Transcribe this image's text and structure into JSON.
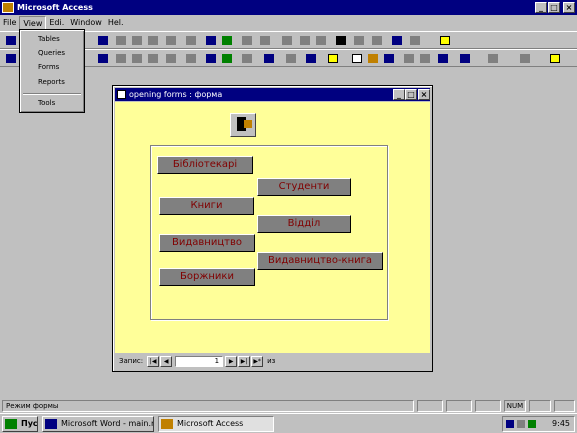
{
  "app": {
    "title": "Microsoft Access"
  },
  "window_buttons": [
    "_",
    "□",
    "×"
  ],
  "menu": [
    "File",
    "View",
    "Edi.",
    "Window",
    "Hel."
  ],
  "view_menu": {
    "items": [
      "Tables",
      "Queries",
      "Forms",
      "Reports"
    ],
    "last": "Tools"
  },
  "form": {
    "title": "opening forms : форма",
    "buttons": [
      "Бібліотекарі",
      "Студенти",
      "Книги",
      "Відділ",
      "Видавництво",
      "Видавництво-книга",
      "Боржники"
    ],
    "record_label": "Запис:",
    "record_value": "1",
    "record_of": "из"
  },
  "status": {
    "text": "Режим формы",
    "num": "NUM"
  },
  "taskbar": {
    "start": "Пуск",
    "tasks": [
      "Microsoft Word - main.me",
      "Microsoft Access"
    ],
    "clock": "9:45"
  },
  "colors": {
    "form_bg": "#ffff99",
    "button_text": "#800000",
    "titlebar": "#000080"
  }
}
